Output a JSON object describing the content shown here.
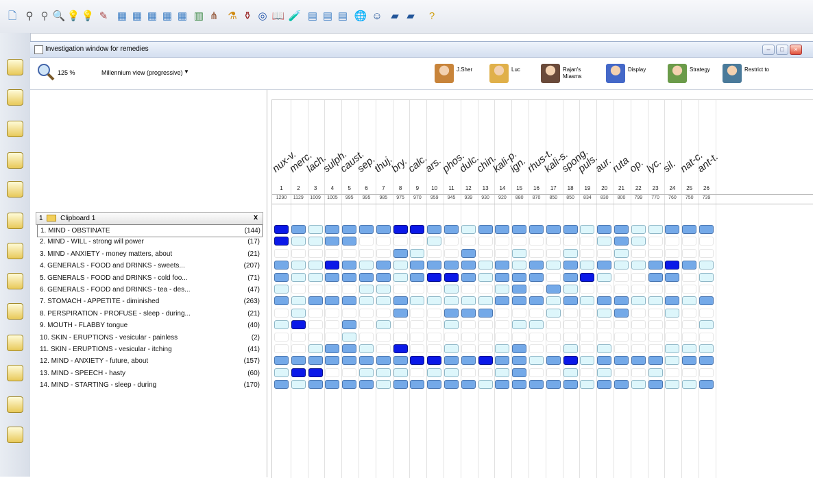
{
  "toolbar": {
    "icons": [
      "new-icon",
      "binoculars-icon",
      "glasses-icon",
      "search-icon",
      "lightbulb-icon",
      "lightbulb-2-icon",
      "edit-icon",
      "doc-icon",
      "doc2-icon",
      "doc3-icon",
      "doc4-icon",
      "doc5-icon",
      "chart-icon",
      "tree-icon",
      "flask-icon",
      "pot-icon",
      "circle-icon",
      "book-icon",
      "bottle-icon",
      "page-icon",
      "page2-icon",
      "page3-icon",
      "globe-icon",
      "people-icon",
      "car-icon",
      "car2-icon",
      "help-icon"
    ]
  },
  "leftbar": {
    "items": [
      "",
      "",
      "",
      "",
      "",
      "",
      "",
      "",
      "",
      "",
      "",
      "",
      ""
    ]
  },
  "window": {
    "title": "Investigation window for remedies"
  },
  "controls": {
    "zoom": "125 %",
    "view_mode": "Millennium view (progressive)"
  },
  "tools": [
    {
      "name": "j-sherr-tool",
      "label": "J.Sher"
    },
    {
      "name": "luc-tool",
      "label": "Luc"
    },
    {
      "name": "rajan-tool",
      "label": "Rajan's Miasms"
    },
    {
      "name": "display-tool",
      "label": "Display"
    },
    {
      "name": "strategy-tool",
      "label": "Strategy"
    },
    {
      "name": "restrict-tool",
      "label": "Restrict to"
    }
  ],
  "clipboard": {
    "title": "1",
    "name": "Clipboard 1",
    "close": "x"
  },
  "rubrics": [
    {
      "label": "1. MIND - OBSTINATE",
      "count": "(144)"
    },
    {
      "label": "2. MIND - WILL - strong will power",
      "count": "(17)"
    },
    {
      "label": "3. MIND - ANXIETY - money matters, about",
      "count": "(21)"
    },
    {
      "label": "4. GENERALS - FOOD and DRINKS - sweets...",
      "count": "(207)"
    },
    {
      "label": "5. GENERALS - FOOD and DRINKS - cold foo...",
      "count": "(71)"
    },
    {
      "label": "6. GENERALS - FOOD and DRINKS - tea - des...",
      "count": "(47)"
    },
    {
      "label": "7. STOMACH - APPETITE - diminished",
      "count": "(263)"
    },
    {
      "label": "8. PERSPIRATION - PROFUSE - sleep - during...",
      "count": "(21)"
    },
    {
      "label": "9. MOUTH - FLABBY tongue",
      "count": "(40)"
    },
    {
      "label": "10. SKIN - ERUPTIONS - vesicular - painless",
      "count": "(2)"
    },
    {
      "label": "11. SKIN - ERUPTIONS - vesicular - itching",
      "count": "(41)"
    },
    {
      "label": "12. MIND - ANXIETY - future, about",
      "count": "(157)"
    },
    {
      "label": "13. MIND - SPEECH - hasty",
      "count": "(60)"
    },
    {
      "label": "14. MIND - STARTING - sleep - during",
      "count": "(170)"
    }
  ],
  "remedies": [
    {
      "name": "nux-v.",
      "rank": "1",
      "score": "1290"
    },
    {
      "name": "merc.",
      "rank": "2",
      "score": "1129"
    },
    {
      "name": "lach.",
      "rank": "3",
      "score": "1009"
    },
    {
      "name": "sulph.",
      "rank": "4",
      "score": "1005"
    },
    {
      "name": "caust.",
      "rank": "5",
      "score": "995"
    },
    {
      "name": "sep.",
      "rank": "6",
      "score": "995"
    },
    {
      "name": "thuj.",
      "rank": "7",
      "score": "985"
    },
    {
      "name": "bry.",
      "rank": "8",
      "score": "975"
    },
    {
      "name": "calc.",
      "rank": "9",
      "score": "970"
    },
    {
      "name": "ars.",
      "rank": "10",
      "score": "959"
    },
    {
      "name": "phos.",
      "rank": "11",
      "score": "945"
    },
    {
      "name": "dulc.",
      "rank": "12",
      "score": "939"
    },
    {
      "name": "chin.",
      "rank": "13",
      "score": "930"
    },
    {
      "name": "kali-p.",
      "rank": "14",
      "score": "920"
    },
    {
      "name": "ign.",
      "rank": "15",
      "score": "880"
    },
    {
      "name": "rhus-t.",
      "rank": "16",
      "score": "870"
    },
    {
      "name": "kali-s.",
      "rank": "17",
      "score": "850"
    },
    {
      "name": "spong.",
      "rank": "18",
      "score": "850"
    },
    {
      "name": "puls.",
      "rank": "19",
      "score": "834"
    },
    {
      "name": "aur.",
      "rank": "20",
      "score": "830"
    },
    {
      "name": "ruta",
      "rank": "21",
      "score": "800"
    },
    {
      "name": "op.",
      "rank": "22",
      "score": "799"
    },
    {
      "name": "lyc.",
      "rank": "23",
      "score": "770"
    },
    {
      "name": "sil.",
      "rank": "24",
      "score": "760"
    },
    {
      "name": "nat-c.",
      "rank": "25",
      "score": "750"
    },
    {
      "name": "ant-t.",
      "rank": "26",
      "score": "739"
    }
  ],
  "grades": [
    "32122223322122222212211222",
    "31122000010000000001210000",
    "00000002100200100100100000",
    "21132121222212121212112321",
    "21122221233212220231002201",
    "10000110001001202100000000",
    "21222112111112221212211212",
    "01000002002220001001200100",
    "13002010001000110000000001",
    "00001000000000000000000000",
    "00122103001001200101000111",
    "22222222332232212312222122",
    "13300111011001200101001000",
    "21222212222212222212212112"
  ],
  "colors": {
    "grade1": "#ddf6fb",
    "grade2": "#74a9e8",
    "grade3": "#0b19e8"
  }
}
